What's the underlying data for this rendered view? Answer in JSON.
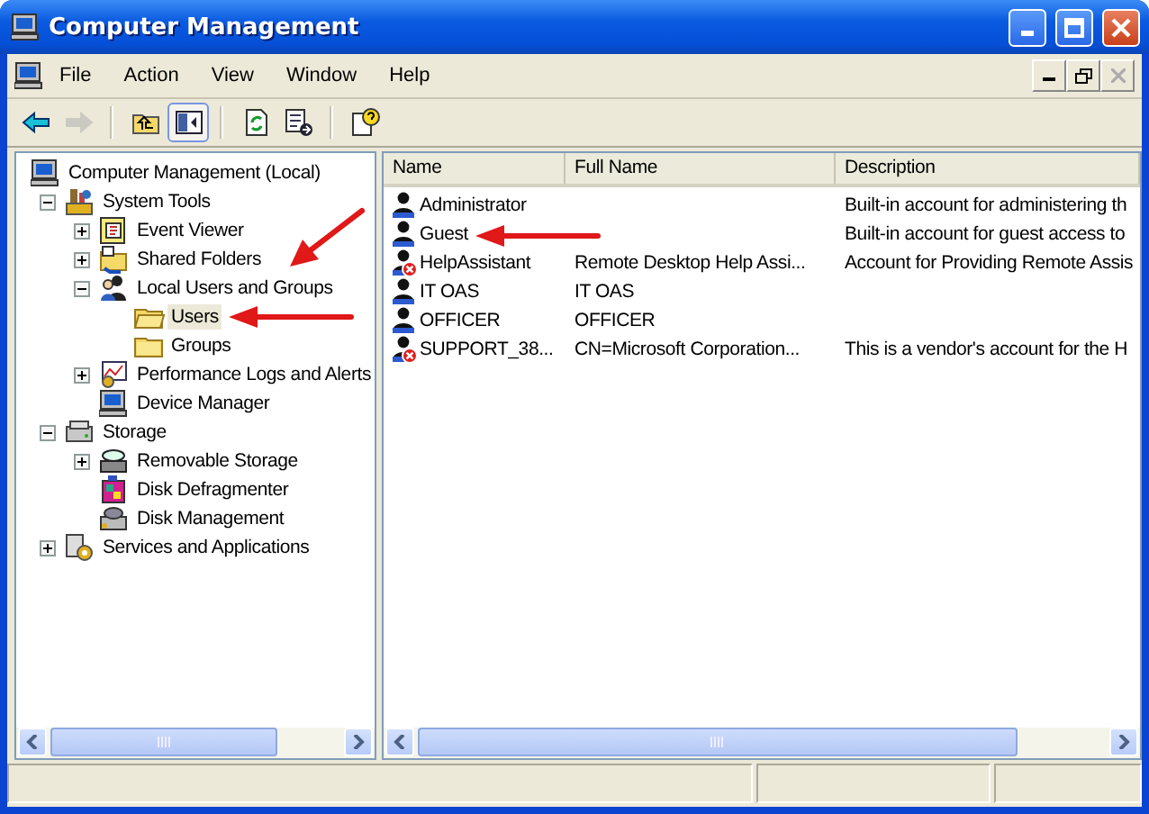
{
  "window": {
    "title": "Computer Management"
  },
  "menu": [
    "File",
    "Action",
    "View",
    "Window",
    "Help"
  ],
  "toolbar": [
    {
      "kind": "back",
      "disabled": false
    },
    {
      "kind": "forward",
      "disabled": true
    },
    {
      "kind": "sep"
    },
    {
      "kind": "up",
      "disabled": false
    },
    {
      "kind": "tree-toggle",
      "disabled": false,
      "pressed": true
    },
    {
      "kind": "sep"
    },
    {
      "kind": "refresh",
      "disabled": false
    },
    {
      "kind": "export",
      "disabled": false
    },
    {
      "kind": "sep"
    },
    {
      "kind": "help",
      "disabled": false
    }
  ],
  "tree": [
    {
      "label": "Computer Management (Local)",
      "selected": false,
      "children": [
        {
          "label": "System Tools",
          "selected": false,
          "expanded": true,
          "children": [
            {
              "label": "Event Viewer",
              "selected": false,
              "expanded": false
            },
            {
              "label": "Shared Folders",
              "selected": false,
              "expanded": false
            },
            {
              "label": "Local Users and Groups",
              "selected": false,
              "expanded": true,
              "arrow": {
                "kind": "from-upper-right"
              },
              "children": [
                {
                  "label": "Users",
                  "selected": true,
                  "arrow": {
                    "kind": "from-right"
                  }
                },
                {
                  "label": "Groups",
                  "selected": false
                }
              ]
            },
            {
              "label": "Performance Logs and Alerts",
              "selected": false,
              "expanded": false
            },
            {
              "label": "Device Manager",
              "selected": false
            }
          ]
        },
        {
          "label": "Storage",
          "selected": false,
          "expanded": true,
          "children": [
            {
              "label": "Removable Storage",
              "selected": false,
              "expanded": false
            },
            {
              "label": "Disk Defragmenter",
              "selected": false
            },
            {
              "label": "Disk Management",
              "selected": false
            }
          ]
        },
        {
          "label": "Services and Applications",
          "selected": false,
          "expanded": false
        }
      ]
    }
  ],
  "list": {
    "columns": [
      "Name",
      "Full Name",
      "Description"
    ],
    "rows": [
      {
        "name": "Administrator",
        "full_name": "",
        "description": "Built-in account for administering th",
        "disabled": false
      },
      {
        "name": "Guest",
        "full_name": "",
        "description": "Built-in account for guest access to",
        "disabled": false,
        "arrow": {
          "kind": "from-right"
        }
      },
      {
        "name": "HelpAssistant",
        "full_name": "Remote Desktop Help Assi...",
        "description": "Account for Providing Remote Assis",
        "disabled": true
      },
      {
        "name": "IT OAS",
        "full_name": "IT OAS",
        "description": "",
        "disabled": false
      },
      {
        "name": "OFFICER",
        "full_name": "OFFICER",
        "description": "",
        "disabled": false
      },
      {
        "name": "SUPPORT_38...",
        "full_name": "CN=Microsoft Corporation...",
        "description": "This is a vendor's account for the H",
        "disabled": true
      }
    ]
  }
}
